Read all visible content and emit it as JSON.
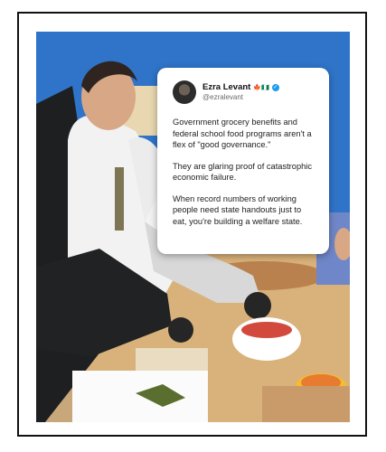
{
  "tweet": {
    "display_name": "Ezra Levant",
    "handle": "@ezralevant",
    "flag_emojis": "🍁🇳🇬",
    "verified_icon": "verified-badge-icon",
    "paragraphs": [
      "Government grocery benefits and federal school food programs aren't a flex of \"good governance.\"",
      "They are glaring proof of catastrophic economic failure.",
      "When record numbers of working people need state handouts just to eat, you're building a welfare state."
    ]
  },
  "photo": {
    "scene": "people-preparing-fruit-plates-icon",
    "background_color": "#2f74c8"
  }
}
